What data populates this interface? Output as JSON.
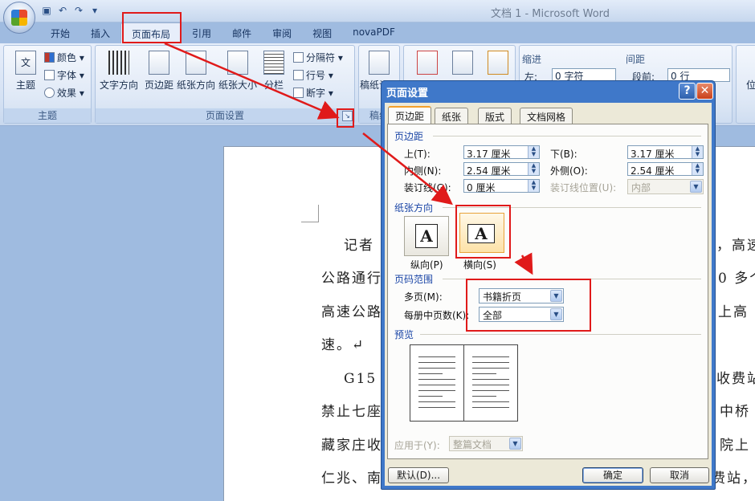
{
  "window": {
    "title": "文档 1 - Microsoft Word"
  },
  "qat": {
    "icons": [
      "save-icon",
      "undo-icon",
      "redo-icon",
      "customize-icon"
    ]
  },
  "ribbon": {
    "tabs": [
      {
        "id": "home",
        "label": "开始"
      },
      {
        "id": "insert",
        "label": "插入"
      },
      {
        "id": "layout",
        "label": "页面布局"
      },
      {
        "id": "references",
        "label": "引用"
      },
      {
        "id": "mailings",
        "label": "邮件"
      },
      {
        "id": "review",
        "label": "审阅"
      },
      {
        "id": "view",
        "label": "视图"
      },
      {
        "id": "novapdf",
        "label": "novaPDF"
      }
    ],
    "active_tab": "页面布局",
    "theme_group": {
      "label": "主题",
      "theme_btn": "主题",
      "colors": "颜色",
      "fonts": "字体",
      "effects": "效果",
      "theme_icon_text": "文"
    },
    "page_setup_group": {
      "label": "页面设置",
      "text_direction": "文字方向",
      "margins": "页边距",
      "orientation": "纸张方向",
      "size": "纸张大小",
      "columns": "分栏",
      "breaks": "分隔符",
      "line_numbers": "行号",
      "hyphenation": "断字"
    },
    "draft_group": {
      "label": "稿纸",
      "btn": "稿纸设置"
    },
    "paragraph_group": {
      "indent": "缩进",
      "spacing": "间距",
      "indent_left_label": "左:",
      "indent_left_value": "0 字符",
      "spacing_before_label": "段前:",
      "spacing_before_value": "0 行",
      "position": "位"
    }
  },
  "document": {
    "lines": [
      "记者",
      "，高速",
      "公路通行",
      "0 多个",
      "高速公路",
      "上高",
      "速。↵",
      "G15 沈",
      "收费站",
      "禁止七座",
      "中桥",
      "藏家庄收",
      "院上",
      "仁兆、南",
      "费站，"
    ]
  },
  "dialog": {
    "title": "页面设置",
    "help": "?",
    "close": "✕",
    "tabs": [
      "页边距",
      "纸张",
      "版式",
      "文档网格"
    ],
    "margins_section": "页边距",
    "top_label": "上(T):",
    "top_value": "3.17 厘米",
    "bottom_label": "下(B):",
    "bottom_value": "3.17 厘米",
    "inside_label": "内侧(N):",
    "inside_value": "2.54 厘米",
    "outside_label": "外侧(O):",
    "outside_value": "2.54 厘米",
    "gutter_label": "装订线(G):",
    "gutter_value": "0 厘米",
    "gutter_pos_label": "装订线位置(U):",
    "gutter_pos_value": "内部",
    "orientation_section": "纸张方向",
    "portrait_label": "纵向(P)",
    "landscape_label": "横向(S)",
    "orientation_glyph": "A",
    "pages_section": "页码范围",
    "multiple_pages_label": "多页(M):",
    "multiple_pages_value": "书籍折页",
    "sheets_label": "每册中页数(K):",
    "sheets_value": "全部",
    "preview_section": "预览",
    "apply_label": "应用于(Y):",
    "apply_value": "整篇文档",
    "default_btn": "默认(D)...",
    "ok_btn": "确定",
    "cancel_btn": "取消"
  },
  "annotation_color": "#e01a1a"
}
